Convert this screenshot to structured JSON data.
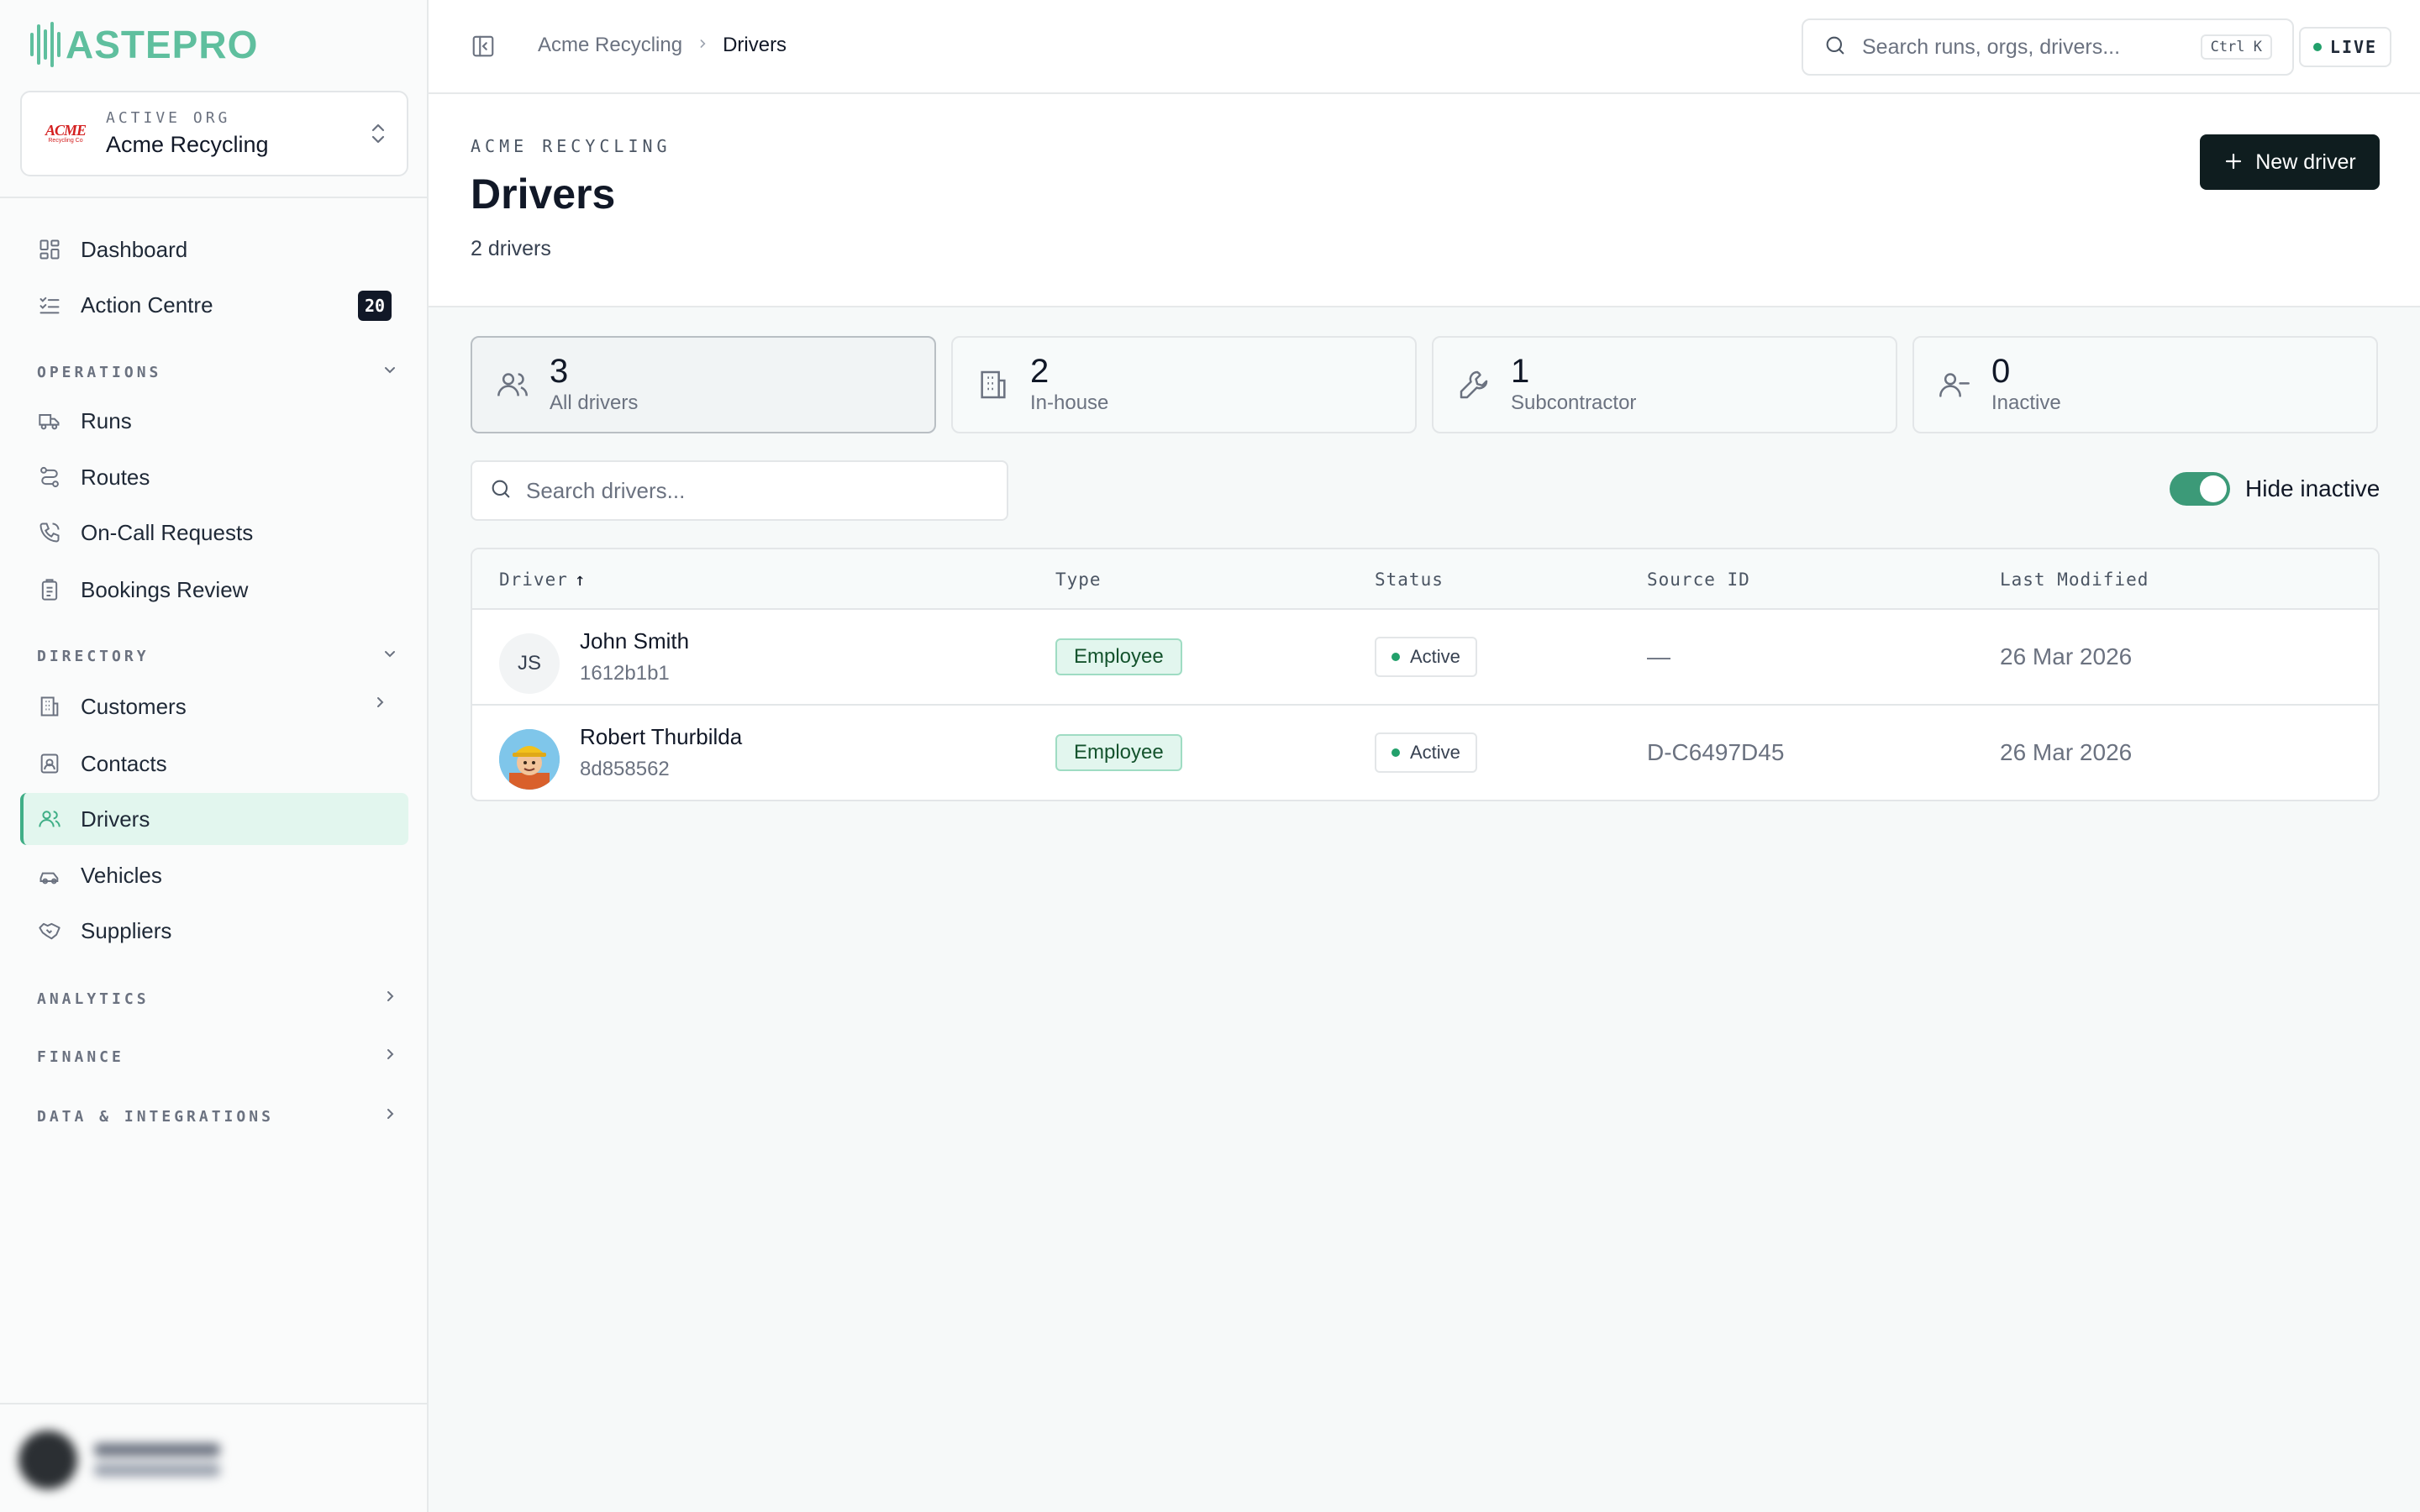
{
  "brand": {
    "logo_text": "ASTEPRO"
  },
  "org": {
    "label": "ACTIVE ORG",
    "name": "Acme Recycling",
    "logo_text": "ACME",
    "logo_sub": "Recycling Co"
  },
  "nav": {
    "dashboard": "Dashboard",
    "action_centre": "Action Centre",
    "action_centre_badge": "20",
    "sections": {
      "operations": "OPERATIONS",
      "directory": "DIRECTORY",
      "analytics": "ANALYTICS",
      "finance": "FINANCE",
      "data": "DATA & INTEGRATIONS"
    },
    "operations": [
      "Runs",
      "Routes",
      "On-Call Requests",
      "Bookings Review"
    ],
    "directory": [
      "Customers",
      "Contacts",
      "Drivers",
      "Vehicles",
      "Suppliers"
    ],
    "active_item": "Drivers"
  },
  "topbar": {
    "breadcrumb": [
      "Acme Recycling",
      "Drivers"
    ],
    "search_placeholder": "Search runs, orgs, drivers...",
    "shortcut": "Ctrl K",
    "live_label": "LIVE"
  },
  "header": {
    "eyebrow": "ACME RECYCLING",
    "title": "Drivers",
    "subtitle": "2 drivers",
    "new_button": "New driver"
  },
  "stats": [
    {
      "value": "3",
      "label": "All drivers",
      "icon": "users-icon",
      "active": true
    },
    {
      "value": "2",
      "label": "In-house",
      "icon": "building-icon",
      "active": false
    },
    {
      "value": "1",
      "label": "Subcontractor",
      "icon": "wrench-icon",
      "active": false
    },
    {
      "value": "0",
      "label": "Inactive",
      "icon": "user-minus-icon",
      "active": false
    }
  ],
  "filters": {
    "search_placeholder": "Search drivers...",
    "hide_inactive_label": "Hide inactive",
    "hide_inactive": true
  },
  "table": {
    "columns": [
      "Driver",
      "Type",
      "Status",
      "Source ID",
      "Last Modified"
    ],
    "sort_indicator": "↑",
    "rows": [
      {
        "initials": "JS",
        "name": "John Smith",
        "id": "1612b1b1",
        "type": "Employee",
        "status": "Active",
        "source_id": "—",
        "last_modified": "26 Mar 2026"
      },
      {
        "initials": "",
        "name": "Robert Thurbilda",
        "id": "8d858562",
        "type": "Employee",
        "status": "Active",
        "source_id": "D-C6497D45",
        "last_modified": "26 Mar 2026"
      }
    ]
  },
  "colors": {
    "accent": "#3fae86",
    "brand": "#5fbf9e",
    "primary_button": "#0f1d1f"
  }
}
